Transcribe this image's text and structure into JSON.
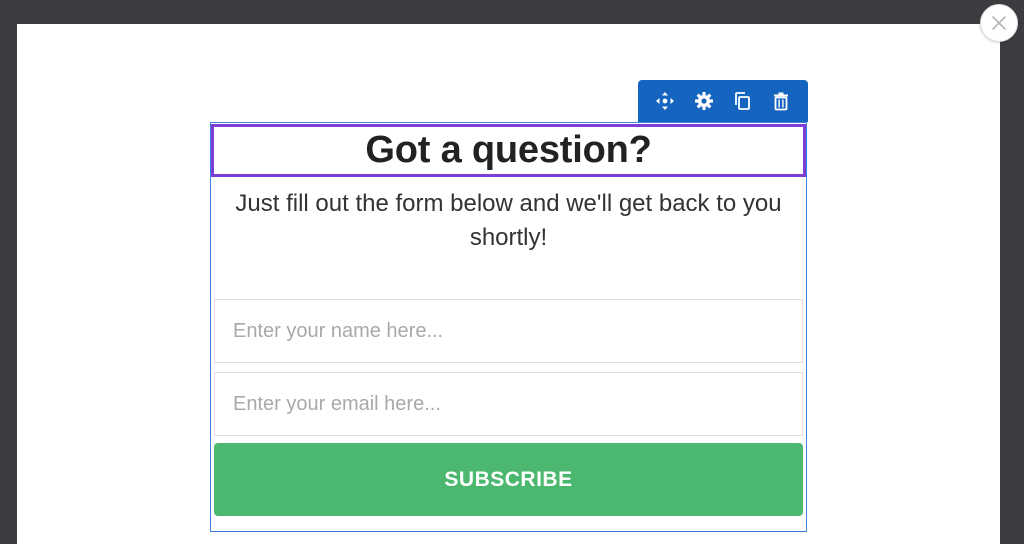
{
  "editor": {
    "toolbar": {
      "move_icon": "move-icon",
      "settings_icon": "gear-icon",
      "duplicate_icon": "copy-icon",
      "delete_icon": "trash-icon",
      "color": "#1565c0"
    },
    "close_icon": "close-icon"
  },
  "form": {
    "heading": "Got a question?",
    "subtext": "Just fill out the form below and we'll get back to you shortly!",
    "name_placeholder": "Enter your name here...",
    "email_placeholder": "Enter your email here...",
    "submit_label": "SUBSCRIBE",
    "submit_color": "#4cb86f",
    "heading_border_color": "#7b3fd6"
  }
}
